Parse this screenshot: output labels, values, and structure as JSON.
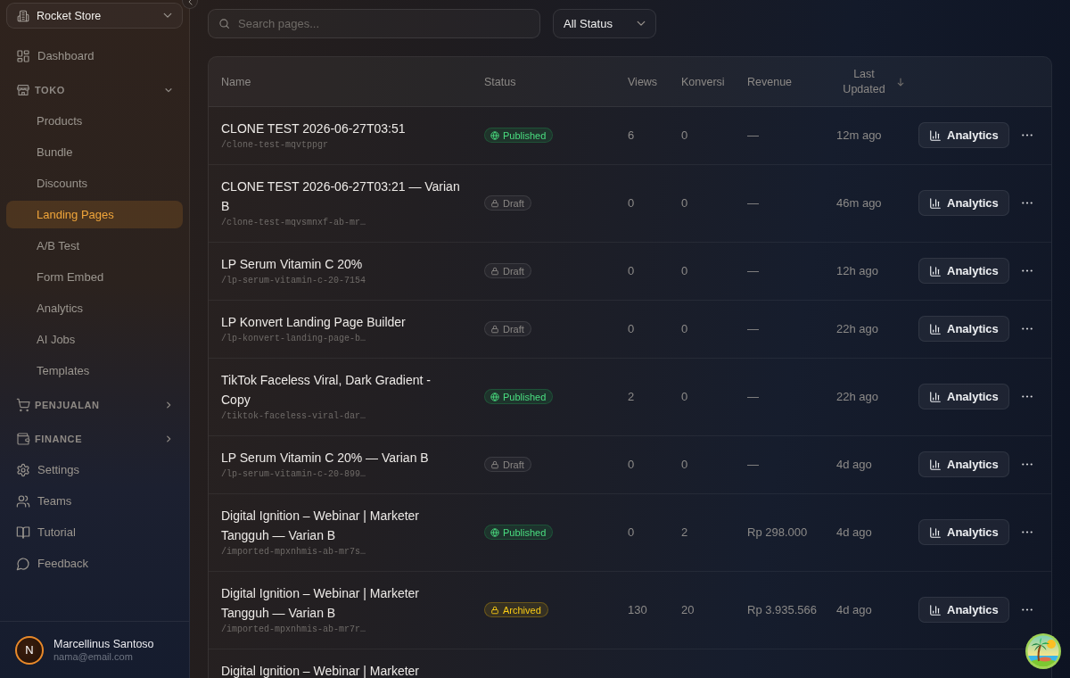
{
  "sidebar": {
    "store_selector": {
      "label": "Rocket Store"
    },
    "nav": [
      {
        "kind": "link",
        "label": "Dashboard",
        "selected": false
      },
      {
        "kind": "section",
        "label": "TOKO",
        "expanded": true,
        "children": [
          {
            "label": "Products",
            "selected": false
          },
          {
            "label": "Bundle",
            "selected": false
          },
          {
            "label": "Discounts",
            "selected": false
          },
          {
            "label": "Landing Pages",
            "selected": true
          },
          {
            "label": "A/B Test",
            "selected": false
          },
          {
            "label": "Form Embed",
            "selected": false
          },
          {
            "label": "Analytics",
            "selected": false
          },
          {
            "label": "AI Jobs",
            "selected": false
          },
          {
            "label": "Templates",
            "selected": false
          }
        ]
      },
      {
        "kind": "section",
        "label": "PENJUALAN",
        "expanded": false
      },
      {
        "kind": "section",
        "label": "FINANCE",
        "expanded": false
      },
      {
        "kind": "link",
        "label": "Settings",
        "selected": false
      },
      {
        "kind": "link",
        "label": "Teams",
        "selected": false
      },
      {
        "kind": "link",
        "label": "Tutorial",
        "selected": false
      },
      {
        "kind": "link",
        "label": "Feedback",
        "selected": false
      }
    ],
    "user": {
      "initial": "N",
      "name": "Marcellinus Santoso",
      "email": "nama@email.com"
    }
  },
  "toolbar": {
    "search": {
      "placeholder": "Search pages..."
    },
    "status_filter": {
      "value": "All Status"
    }
  },
  "table": {
    "columns": [
      {
        "label": "Name",
        "sorted": false
      },
      {
        "label": "Status",
        "sorted": false
      },
      {
        "label": "Views",
        "sorted": false
      },
      {
        "label": "Konversi",
        "sorted": false
      },
      {
        "label": "Revenue",
        "sorted": false
      },
      {
        "label": "Last Updated",
        "sorted": true
      }
    ],
    "rows": [
      {
        "name": "CLONE TEST 2026-06-27T03:51",
        "slug": "/clone-test-mqvtppgr",
        "status": {
          "label": "Published",
          "kind": "published"
        },
        "views": "6",
        "conversions": "0",
        "revenue": "—",
        "updated": "12m ago",
        "action": "Analytics"
      },
      {
        "name": "CLONE TEST 2026-06-27T03:21 — Varian B",
        "slug": "/clone-test-mqvsmnxf-ab-mr…",
        "status": {
          "label": "Draft",
          "kind": "draft"
        },
        "views": "0",
        "conversions": "0",
        "revenue": "—",
        "updated": "46m ago",
        "action": "Analytics"
      },
      {
        "name": "LP Serum Vitamin C 20%",
        "slug": "/lp-serum-vitamin-c-20-7154",
        "status": {
          "label": "Draft",
          "kind": "draft"
        },
        "views": "0",
        "conversions": "0",
        "revenue": "—",
        "updated": "12h ago",
        "action": "Analytics"
      },
      {
        "name": "LP Konvert Landing Page Builder",
        "slug": "/lp-konvert-landing-page-b…",
        "status": {
          "label": "Draft",
          "kind": "draft"
        },
        "views": "0",
        "conversions": "0",
        "revenue": "—",
        "updated": "22h ago",
        "action": "Analytics"
      },
      {
        "name": "TikTok Faceless Viral, Dark Gradient - Copy",
        "slug": "/tiktok-faceless-viral-dar…",
        "status": {
          "label": "Published",
          "kind": "published"
        },
        "views": "2",
        "conversions": "0",
        "revenue": "—",
        "updated": "22h ago",
        "action": "Analytics"
      },
      {
        "name": "LP Serum Vitamin C 20% — Varian B",
        "slug": "/lp-serum-vitamin-c-20-899…",
        "status": {
          "label": "Draft",
          "kind": "draft"
        },
        "views": "0",
        "conversions": "0",
        "revenue": "—",
        "updated": "4d ago",
        "action": "Analytics"
      },
      {
        "name": "Digital Ignition – Webinar | Marketer Tangguh — Varian B",
        "slug": "/imported-mpxnhmis-ab-mr7s…",
        "status": {
          "label": "Published",
          "kind": "published"
        },
        "views": "0",
        "conversions": "2",
        "revenue": "Rp 298.000",
        "updated": "4d ago",
        "action": "Analytics"
      },
      {
        "name": "Digital Ignition – Webinar | Marketer Tangguh — Varian B",
        "slug": "/imported-mpxnhmis-ab-mr7r…",
        "status": {
          "label": "Archived",
          "kind": "archived"
        },
        "views": "130",
        "conversions": "20",
        "revenue": "Rp 3.935.566",
        "updated": "4d ago",
        "action": "Analytics"
      },
      {
        "name": "Digital Ignition – Webinar | Marketer"
      }
    ]
  }
}
